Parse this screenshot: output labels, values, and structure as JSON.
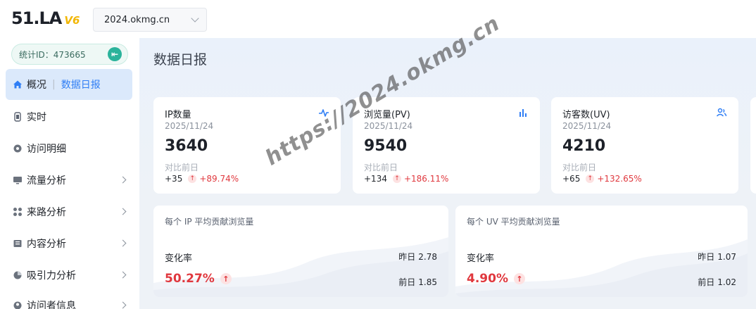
{
  "app": {
    "logo_text": "51.LA",
    "logo_version": "V6"
  },
  "site_selector": {
    "value": "2024.okmg.cn"
  },
  "sidebar": {
    "stat_id": "统计ID：473665",
    "items": [
      {
        "label": "概况",
        "sub": "数据日报",
        "icon": "home-icon",
        "active": true
      },
      {
        "label": "实时",
        "icon": "watch-icon"
      },
      {
        "label": "访问明细",
        "icon": "disc-icon"
      },
      {
        "label": "流量分析",
        "icon": "monitor-icon",
        "expandable": true
      },
      {
        "label": "来路分析",
        "icon": "nodes-icon",
        "expandable": true
      },
      {
        "label": "内容分析",
        "icon": "book-icon",
        "expandable": true
      },
      {
        "label": "吸引力分析",
        "icon": "pie-icon",
        "expandable": true
      },
      {
        "label": "访问者信息",
        "icon": "user-icon",
        "expandable": true
      }
    ]
  },
  "main": {
    "title": "数据日报",
    "kpis": [
      {
        "label": "IP数量",
        "date": "2025/11/24",
        "value": "3640",
        "compare_label": "对比前日",
        "delta": "+35",
        "pct": "+89.74%",
        "icon": "pulse-icon"
      },
      {
        "label": "浏览量(PV)",
        "date": "2025/11/24",
        "value": "9540",
        "compare_label": "对比前日",
        "delta": "+134",
        "pct": "+186.11%",
        "icon": "bar-chart-icon"
      },
      {
        "label": "访客数(UV)",
        "date": "2025/11/24",
        "value": "4210",
        "compare_label": "对比前日",
        "delta": "+65",
        "pct": "+132.65%",
        "icon": "users-icon"
      }
    ],
    "ratios": [
      {
        "title": "每个 IP 平均贡献浏览量",
        "rate_label": "变化率",
        "rate": "50.27%",
        "yesterday_label": "昨日",
        "yesterday": "2.78",
        "prev_label": "前日",
        "prev": "1.85"
      },
      {
        "title": "每个 UV 平均贡献浏览量",
        "rate_label": "变化率",
        "rate": "4.90%",
        "yesterday_label": "昨日",
        "yesterday": "1.07",
        "prev_label": "前日",
        "prev": "1.02"
      }
    ],
    "watermark": "https://2024.okmg.cn"
  },
  "colors": {
    "accent": "#2f7ef5",
    "up": "#e0383e",
    "brand_green": "#2bb39b",
    "logo_yellow": "#f2b705"
  }
}
